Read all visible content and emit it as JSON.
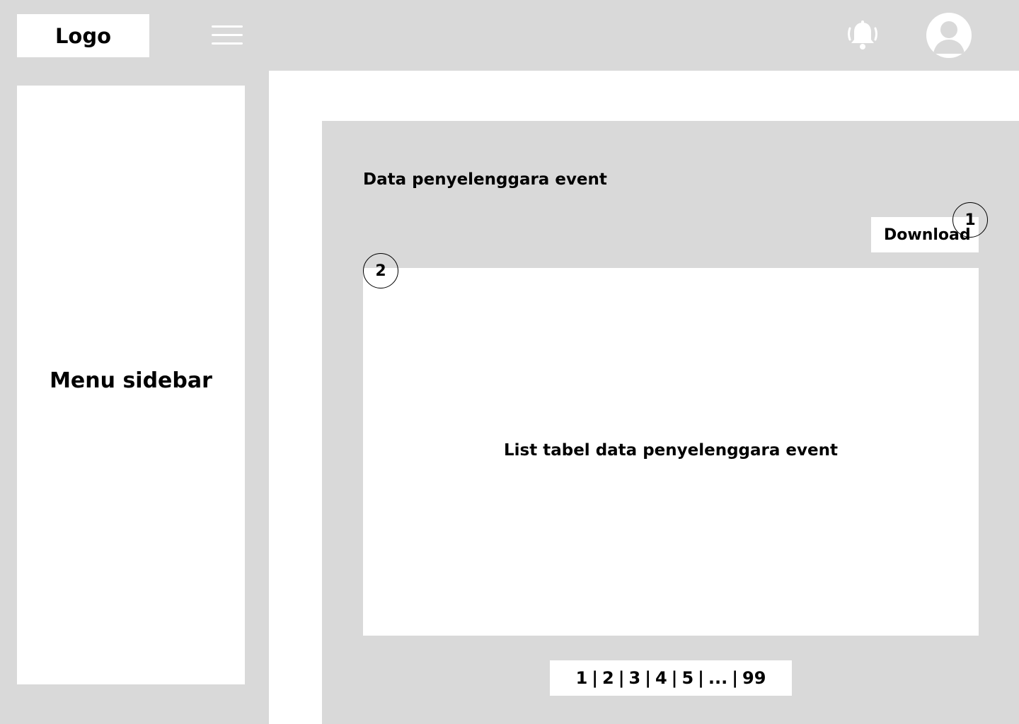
{
  "header": {
    "logo_text": "Logo",
    "menu_icon": "hamburger-menu-icon",
    "notification_icon": "bell-ringing-icon",
    "avatar_icon": "user-avatar-icon"
  },
  "sidebar": {
    "label": "Menu sidebar"
  },
  "main": {
    "title": "Data penyelenggara event",
    "download_label": "Download",
    "annotation_1": "1",
    "annotation_2": "2",
    "table_placeholder": "List tabel data penyelenggara event"
  },
  "pagination": {
    "pages": [
      "1",
      "2",
      "3",
      "4",
      "5",
      "...",
      "99"
    ],
    "separator": "|"
  },
  "colors": {
    "background": "#d9d9d9",
    "surface": "#ffffff",
    "text": "#000000"
  }
}
